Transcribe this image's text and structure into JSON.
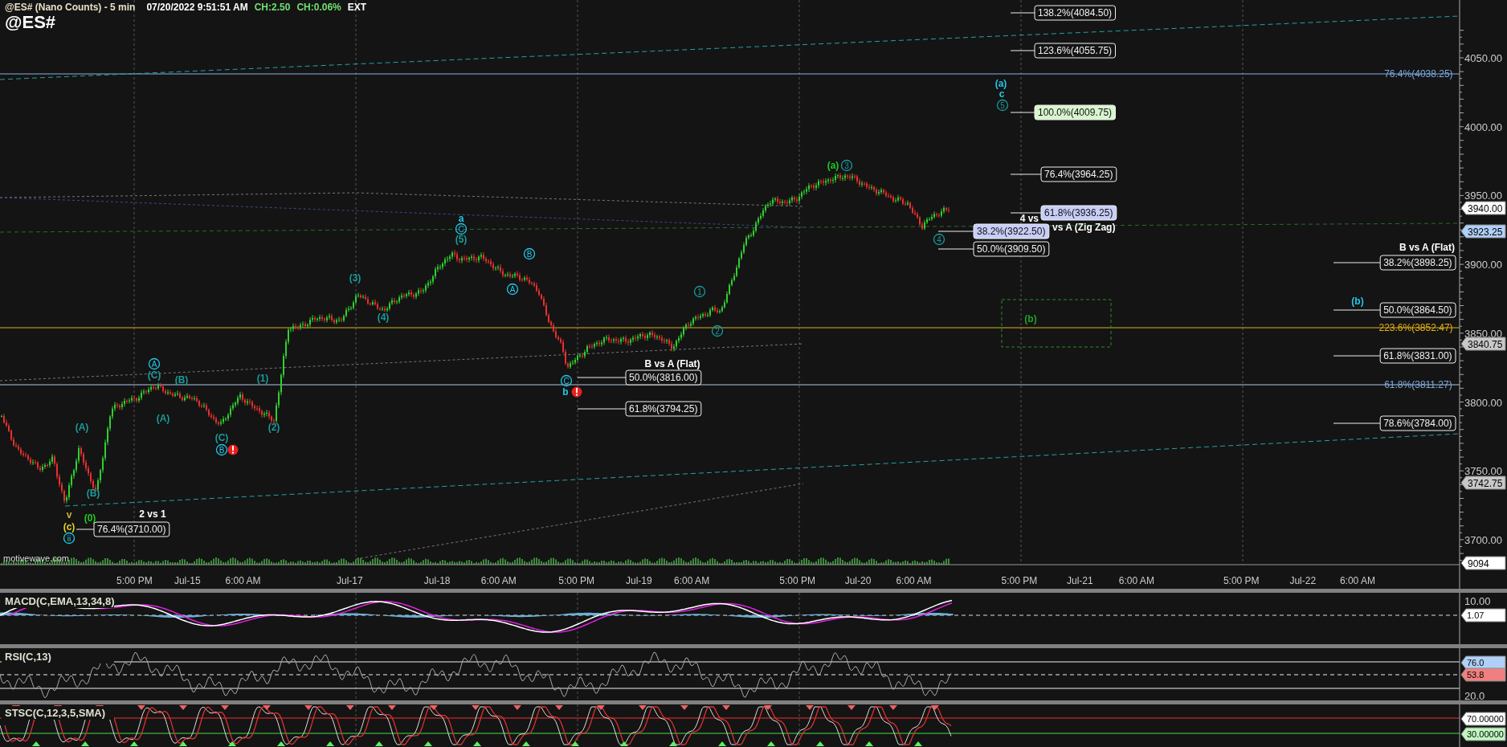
{
  "header": {
    "title": "@ES# (Nano Counts) - 5 min",
    "datetime": "07/20/2022 9:51:51 AM",
    "change": "CH:2.50",
    "change_percent": "CH:0.06%",
    "session": "EXT",
    "symbol": "@ES#"
  },
  "price_chart": {
    "fib_labels": [
      {
        "text": "138.2%(4084.50)",
        "kind": "boxed"
      },
      {
        "text": "123.6%(4055.75)",
        "kind": "boxed"
      },
      {
        "text": "100.0%(4009.75)",
        "kind": "boxed-green"
      },
      {
        "text": "76.4%(3964.25)",
        "kind": "boxed"
      },
      {
        "text": "61.8%(3936.25)",
        "kind": "boxed-blue"
      },
      {
        "text": "38.2%(3922.50)",
        "kind": "boxed-blue"
      },
      {
        "text": "50.0%(3909.50)",
        "kind": "boxed"
      },
      {
        "text": "76.4%(4038.25)",
        "kind": "plain-blue"
      },
      {
        "text": "38.2%(3898.25)",
        "kind": "boxed"
      },
      {
        "text": "50.0%(3864.50)",
        "kind": "boxed"
      },
      {
        "text": "223.6%(3852.47)",
        "kind": "plain-orange"
      },
      {
        "text": "61.8%(3831.00)",
        "kind": "boxed"
      },
      {
        "text": "61.8%(3811.27)",
        "kind": "plain-blue"
      },
      {
        "text": "78.6%(3784.00)",
        "kind": "boxed"
      },
      {
        "text": "50.0%(3816.00)",
        "kind": "boxed"
      },
      {
        "text": "61.8%(3794.25)",
        "kind": "boxed"
      },
      {
        "text": "76.4%(3710.00)",
        "kind": "boxed"
      }
    ],
    "annotations": [
      "4 vs",
      "vs A (Zig Zag)",
      "B vs A (Flat)",
      "2 vs 1",
      "B vs A (Flat)"
    ],
    "wave_labels": [
      {
        "text": "(a)",
        "kind": "plain",
        "color": "#22c822"
      },
      {
        "text": "3",
        "kind": "circled",
        "color": "#1a9a9a"
      },
      {
        "text": "4",
        "kind": "circled",
        "color": "#1a9a9a"
      },
      {
        "text": "(a)",
        "kind": "plain",
        "color": "#22c8e8"
      },
      {
        "text": "c",
        "kind": "plain",
        "color": "#22c8e8"
      },
      {
        "text": "5",
        "kind": "circled",
        "color": "#1a9a9a"
      },
      {
        "text": "(b)",
        "kind": "plain",
        "color": "#22c8e8"
      },
      {
        "text": "a",
        "kind": "plain",
        "color": "#22c8e8"
      },
      {
        "text": "C",
        "kind": "circled",
        "color": "#22c8e8"
      },
      {
        "text": "(5)",
        "kind": "plain",
        "color": "#1a9a9a"
      },
      {
        "text": "B",
        "kind": "circled",
        "color": "#22c8e8"
      },
      {
        "text": "A",
        "kind": "circled",
        "color": "#22c8e8"
      },
      {
        "text": "(3)",
        "kind": "plain",
        "color": "#1a9a9a"
      },
      {
        "text": "(4)",
        "kind": "plain",
        "color": "#1a9a9a"
      },
      {
        "text": "1",
        "kind": "circled",
        "color": "#1a9a9a"
      },
      {
        "text": "2",
        "kind": "circled",
        "color": "#1a9a9a"
      },
      {
        "text": "C",
        "kind": "circled",
        "color": "#22c8e8"
      },
      {
        "text": "b",
        "kind": "plain",
        "color": "#22c8e8"
      },
      {
        "text": "A",
        "kind": "circled",
        "color": "#22c8e8"
      },
      {
        "text": "(C)",
        "kind": "plain",
        "color": "#1a9a9a"
      },
      {
        "text": "(B)",
        "kind": "plain",
        "color": "#1a9a9a"
      },
      {
        "text": "(A)",
        "kind": "plain",
        "color": "#1a9a9a"
      },
      {
        "text": "(1)",
        "kind": "plain",
        "color": "#1a9a9a"
      },
      {
        "text": "(2)",
        "kind": "plain",
        "color": "#1a9a9a"
      },
      {
        "text": "(C)",
        "kind": "plain",
        "color": "#1a9a9a"
      },
      {
        "text": "B",
        "kind": "circled",
        "color": "#22c8e8"
      },
      {
        "text": "(A)",
        "kind": "plain",
        "color": "#1a9a9a"
      },
      {
        "text": "(B)",
        "kind": "plain",
        "color": "#1a9a9a"
      },
      {
        "text": "v",
        "kind": "plain",
        "color": "#c8b040"
      },
      {
        "text": "(0)",
        "kind": "plain",
        "color": "#22c822"
      },
      {
        "text": "(c)",
        "kind": "plain",
        "color": "#e8d020"
      },
      {
        "text": "ii",
        "kind": "circled",
        "color": "#22c8e8"
      },
      {
        "text": "(b)",
        "kind": "plain",
        "color": "#22a022"
      }
    ],
    "source": "motivewave.com",
    "price_axis": {
      "ticks": [
        "4050.00",
        "4000.00",
        "3950.00",
        "3900.00",
        "3850.00",
        "3800.00",
        "3750.00",
        "3700.00"
      ],
      "tags": [
        {
          "text": "3940.00",
          "kind": "white"
        },
        {
          "text": "3923.25",
          "kind": "blue"
        },
        {
          "text": "3840.75",
          "kind": "gray"
        },
        {
          "text": "3742.75",
          "kind": "gray"
        },
        {
          "text": "9094",
          "kind": "white"
        }
      ]
    },
    "time_axis": [
      "5:00 PM",
      "Jul-15",
      "6:00 AM",
      "Jul-17",
      "Jul-18",
      "6:00 AM",
      "5:00 PM",
      "Jul-19",
      "6:00 AM",
      "5:00 PM",
      "Jul-20",
      "6:00 AM",
      "5:00 PM",
      "Jul-21",
      "6:00 AM",
      "5:00 PM",
      "Jul-22",
      "6:00 AM"
    ]
  },
  "indicators": [
    {
      "title": "MACD(C,EMA,13,34,8)",
      "kind": "macd",
      "ticks": [
        "10.00"
      ],
      "tags": [
        {
          "text": "1.07",
          "kind": "white"
        }
      ]
    },
    {
      "title": "RSI(C,13)",
      "kind": "rsi",
      "ticks": [
        "20.0"
      ],
      "tags": [
        {
          "text": "76.0",
          "kind": "blue"
        },
        {
          "text": "53.8",
          "kind": "red"
        }
      ]
    },
    {
      "title": "STSC(C,12,3,5,SMA)",
      "kind": "stoch",
      "tags": [
        {
          "text": "70.00000",
          "kind": "white"
        },
        {
          "text": "30.00000",
          "kind": "green"
        }
      ]
    }
  ]
}
